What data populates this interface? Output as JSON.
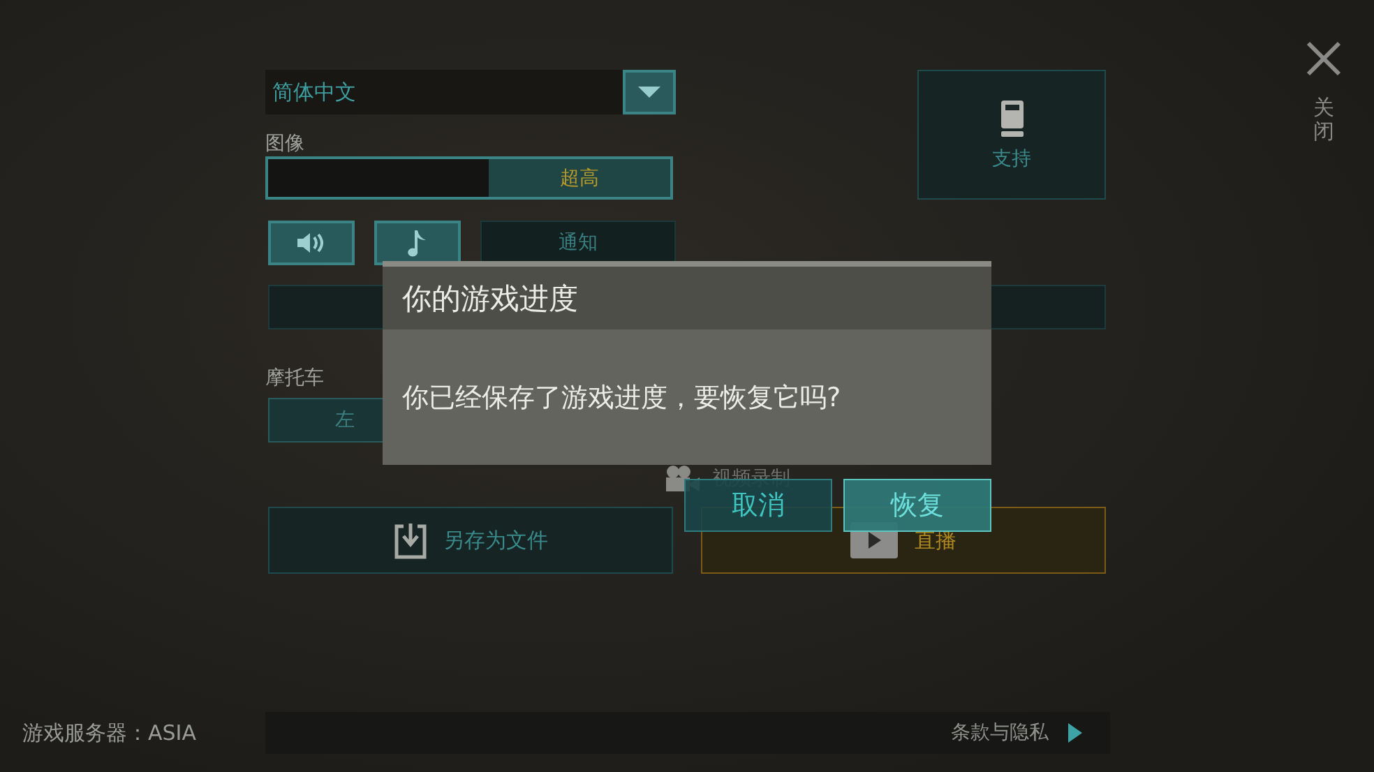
{
  "language": {
    "value": "简体中文"
  },
  "graphics": {
    "label": "图像",
    "value": "超高",
    "level": 1
  },
  "audio_buttons": [
    {
      "kind": "sound",
      "on": true
    },
    {
      "kind": "music",
      "on": true
    }
  ],
  "notification_button": "通知",
  "support_button": "支持",
  "motorcycle": {
    "label": "摩托车",
    "left_button": "左"
  },
  "video_recording": "视频录制",
  "save_button": "另存为文件",
  "live_button": "直播",
  "close": {
    "label": "关闭"
  },
  "server": "游戏服务器：ASIA",
  "terms_link": "条款与隐私",
  "dialog": {
    "title": "你的游戏进度",
    "message": "你已经保存了游戏进度，要恢复它吗?",
    "buttons": [
      {
        "label": "取消",
        "selected": false
      },
      {
        "label": "恢复",
        "selected": true
      }
    ]
  }
}
